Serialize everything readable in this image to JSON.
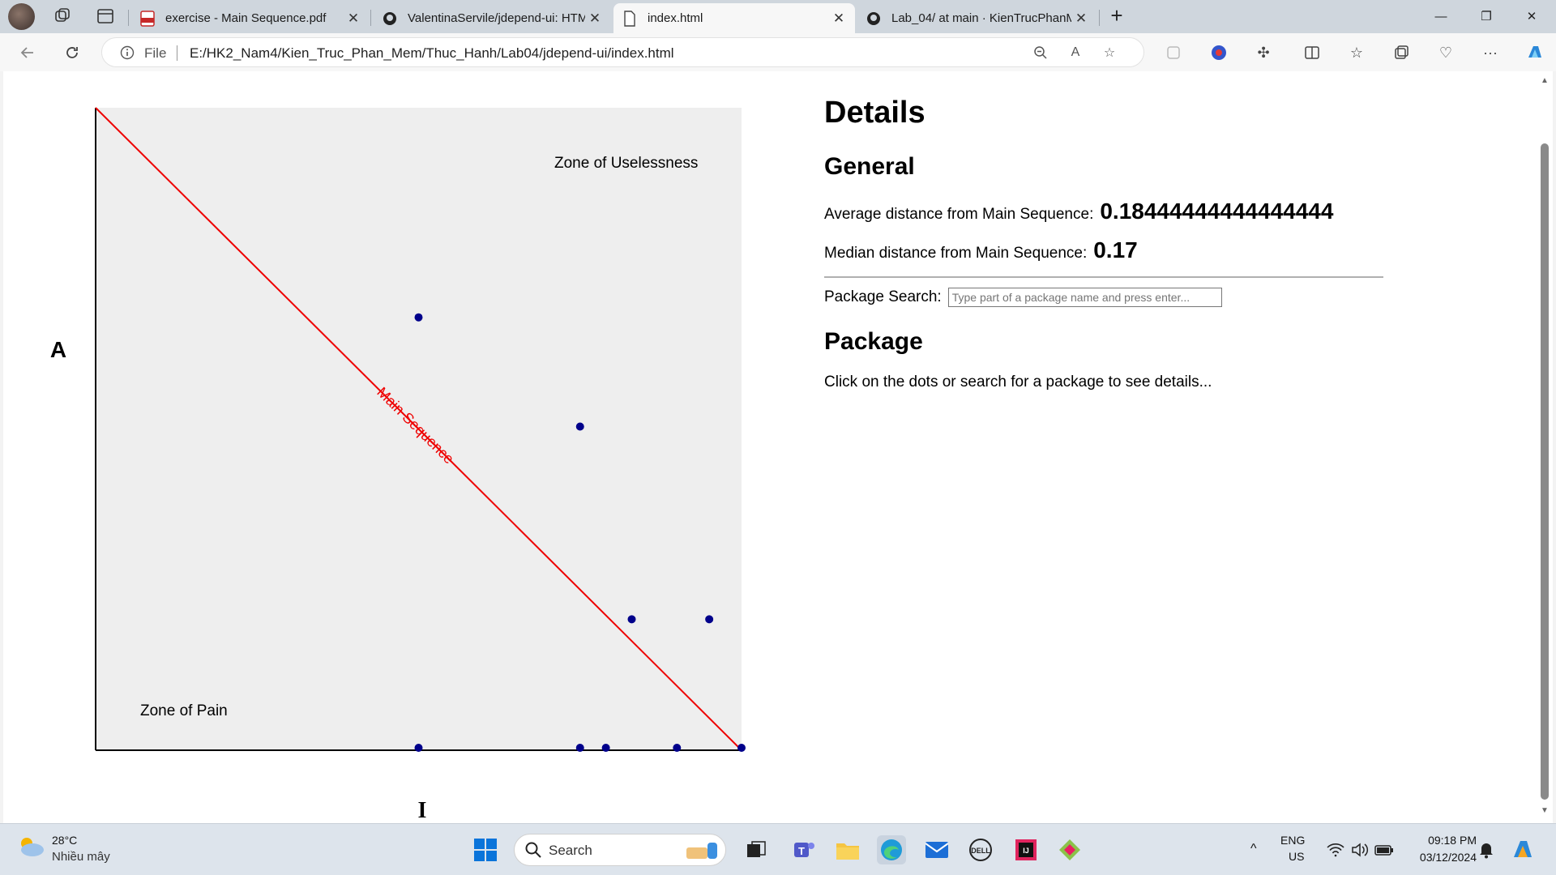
{
  "browser": {
    "tabs": [
      {
        "title": "exercise - Main Sequence.pdf",
        "icon": "pdf-icon",
        "active": false
      },
      {
        "title": "ValentinaServile/jdepend-ui: HTM",
        "icon": "github-icon",
        "active": false
      },
      {
        "title": "index.html",
        "icon": "file-icon",
        "active": true
      },
      {
        "title": "Lab_04/ at main · KienTrucPhanM",
        "icon": "github-icon",
        "active": false
      }
    ],
    "address": {
      "scheme_label": "File",
      "url": "E:/HK2_Nam4/Kien_Truc_Phan_Mem/Thuc_Hanh/Lab04/jdepend-ui/index.html"
    }
  },
  "chart": {
    "ylabel": "A",
    "xlabel": "I",
    "zone_useless": "Zone of Uselessness",
    "zone_pain": "Zone of Pain",
    "main_sequence_label": "Main Sequence",
    "colors": {
      "background": "#eeeeee",
      "line": "#ee0000",
      "dot": "#00008b"
    }
  },
  "chart_data": {
    "type": "scatter",
    "title": "",
    "xlabel": "I",
    "ylabel": "A",
    "xlim": [
      0,
      1
    ],
    "ylim": [
      0,
      1
    ],
    "reference_line": {
      "name": "Main Sequence",
      "from": [
        0,
        1
      ],
      "to": [
        1,
        0
      ]
    },
    "points": [
      {
        "x": 0.5,
        "y": 0.67
      },
      {
        "x": 0.75,
        "y": 0.5
      },
      {
        "x": 0.83,
        "y": 0.2
      },
      {
        "x": 0.95,
        "y": 0.2
      },
      {
        "x": 0.5,
        "y": 0.0
      },
      {
        "x": 0.75,
        "y": 0.0
      },
      {
        "x": 0.79,
        "y": 0.0
      },
      {
        "x": 0.9,
        "y": 0.0
      },
      {
        "x": 1.0,
        "y": 0.0
      }
    ]
  },
  "details": {
    "heading": "Details",
    "general_heading": "General",
    "avg_label": "Average distance from Main Sequence:",
    "avg_value": "0.18444444444444444",
    "median_label": "Median distance from Main Sequence:",
    "median_value": "0.17",
    "search_label": "Package Search:",
    "search_placeholder": "Type part of a package name and press enter...",
    "package_heading": "Package",
    "package_hint": "Click on the dots or search for a package to see details..."
  },
  "taskbar": {
    "temperature": "28°C",
    "weather": "Nhiều mây",
    "search_label": "Search",
    "lang_1": "ENG",
    "lang_2": "US",
    "time": "09:18 PM",
    "date": "03/12/2024"
  }
}
